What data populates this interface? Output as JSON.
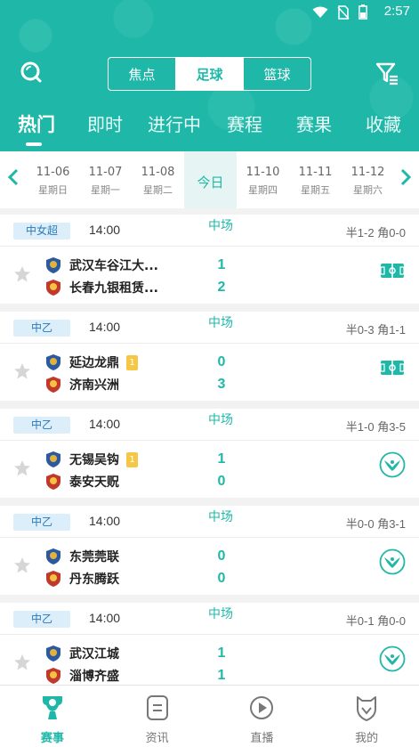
{
  "status_bar": {
    "time": "2:57"
  },
  "segments": [
    {
      "label": "焦点",
      "active": false
    },
    {
      "label": "足球",
      "active": true
    },
    {
      "label": "篮球",
      "active": false
    }
  ],
  "tabs": [
    {
      "label": "热门",
      "active": true
    },
    {
      "label": "即时",
      "active": false
    },
    {
      "label": "进行中",
      "active": false
    },
    {
      "label": "赛程",
      "active": false
    },
    {
      "label": "赛果",
      "active": false
    },
    {
      "label": "收藏",
      "active": false
    }
  ],
  "dates": [
    {
      "date": "11-06",
      "weekday": "星期日"
    },
    {
      "date": "11-07",
      "weekday": "星期一"
    },
    {
      "date": "11-08",
      "weekday": "星期二"
    },
    {
      "date": "今日",
      "weekday": ""
    },
    {
      "date": "11-10",
      "weekday": "星期四"
    },
    {
      "date": "11-11",
      "weekday": "星期五"
    },
    {
      "date": "11-12",
      "weekday": "星期六"
    }
  ],
  "matches": [
    {
      "league": "中女超",
      "time": "14:00",
      "status": "中场",
      "half": "半1-2 角0-0",
      "home": {
        "name": "武汉车谷江大...",
        "score": "1",
        "red_card": ""
      },
      "away": {
        "name": "长春九银租赁...",
        "score": "2",
        "red_card": ""
      },
      "action_icon": "pitch-icon"
    },
    {
      "league": "中乙",
      "time": "14:00",
      "status": "中场",
      "half": "半0-3 角1-1",
      "home": {
        "name": "延边龙鼎",
        "score": "0",
        "red_card": "1"
      },
      "away": {
        "name": "济南兴洲",
        "score": "3",
        "red_card": ""
      },
      "action_icon": "pitch-icon"
    },
    {
      "league": "中乙",
      "time": "14:00",
      "status": "中场",
      "half": "半1-0 角3-5",
      "home": {
        "name": "无锡吴钩",
        "score": "1",
        "red_card": "1"
      },
      "away": {
        "name": "泰安天贶",
        "score": "0",
        "red_card": ""
      },
      "action_icon": "eagle-icon"
    },
    {
      "league": "中乙",
      "time": "14:00",
      "status": "中场",
      "half": "半0-0 角3-1",
      "home": {
        "name": "东莞莞联",
        "score": "0",
        "red_card": ""
      },
      "away": {
        "name": "丹东腾跃",
        "score": "0",
        "red_card": ""
      },
      "action_icon": "eagle-icon"
    },
    {
      "league": "中乙",
      "time": "14:00",
      "status": "中场",
      "half": "半0-1 角0-0",
      "home": {
        "name": "武汉江城",
        "score": "1",
        "red_card": ""
      },
      "away": {
        "name": "淄博齐盛",
        "score": "1",
        "red_card": ""
      },
      "action_icon": "eagle-icon"
    }
  ],
  "bottom_nav": [
    {
      "label": "赛事",
      "icon": "trophy-icon",
      "active": true
    },
    {
      "label": "资讯",
      "icon": "news-icon",
      "active": false
    },
    {
      "label": "直播",
      "icon": "play-icon",
      "active": false
    },
    {
      "label": "我的",
      "icon": "profile-icon",
      "active": false
    }
  ],
  "colors": {
    "brand": "#1fb8a8",
    "league_badge_bg": "#dceef9",
    "red_card": "#f6c646"
  }
}
